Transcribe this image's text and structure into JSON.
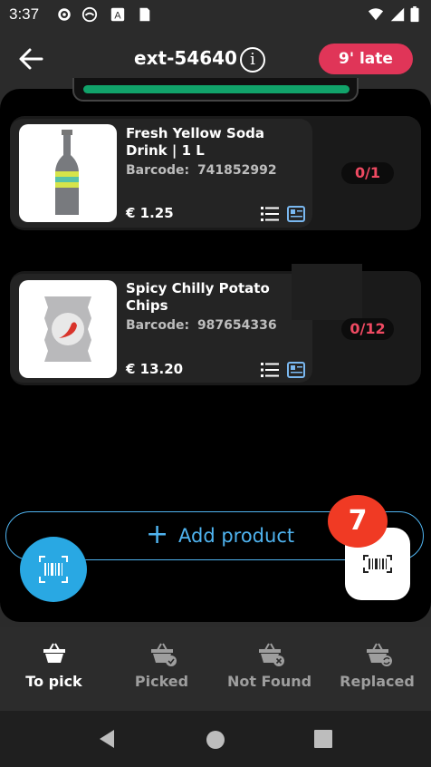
{
  "status_bar": {
    "time": "3:37"
  },
  "header": {
    "order_id": "ext-54640",
    "late_label": "9' late"
  },
  "products": [
    {
      "name": "Fresh Yellow Soda Drink | 1 L",
      "barcode_label": "Barcode:",
      "barcode": "741852992",
      "price": "€ 1.25",
      "quantity": "0/1"
    },
    {
      "name": "Spicy Chilly Potato Chips",
      "barcode_label": "Barcode:",
      "barcode": "987654336",
      "price": "€ 13.20",
      "quantity": "0/12"
    }
  ],
  "add_product": {
    "icon": "+",
    "label": "Add product"
  },
  "scan_badge": "7",
  "tabs": [
    {
      "label": "To pick",
      "active": true
    },
    {
      "label": "Picked",
      "active": false
    },
    {
      "label": "Not Found",
      "active": false
    },
    {
      "label": "Replaced",
      "active": false
    }
  ],
  "colors": {
    "accent": "#4fb3ef",
    "late": "#e03558",
    "progress": "#11a36a",
    "badge": "#f03a24",
    "quantity": "#ef4a62"
  }
}
